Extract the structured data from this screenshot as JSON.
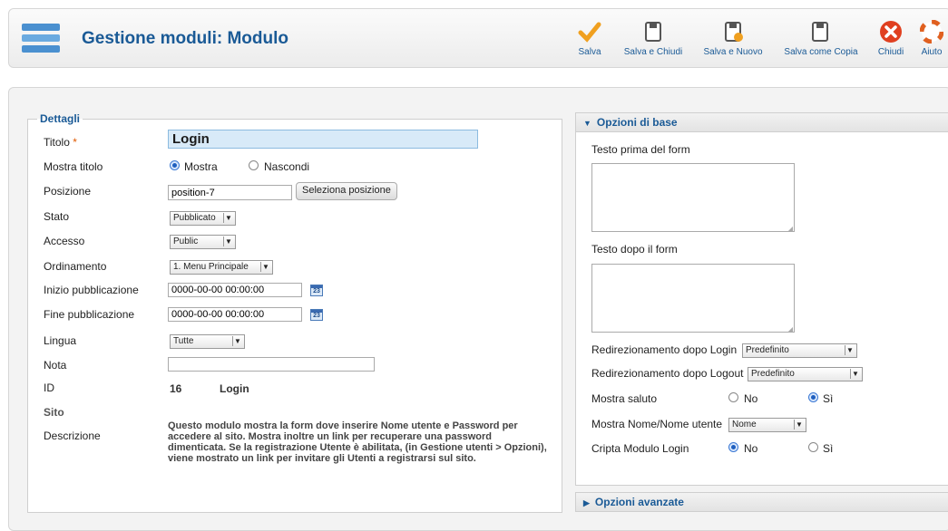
{
  "toolbar": {
    "title": "Gestione moduli: Modulo",
    "buttons": {
      "save": "Salva",
      "save_close": "Salva e Chiudi",
      "save_new": "Salva e Nuovo",
      "save_copy": "Salva come Copia",
      "close": "Chiudi",
      "help": "Aiuto"
    }
  },
  "details": {
    "legend": "Dettagli",
    "title_label": "Titolo",
    "required_mark": "*",
    "title_value": "Login",
    "show_title_label": "Mostra titolo",
    "show_title_options": [
      "Mostra",
      "Nascondi"
    ],
    "show_title_selected": "Mostra",
    "position_label": "Posizione",
    "position_value": "position-7",
    "position_button": "Seleziona posizione",
    "state_label": "Stato",
    "state_value": "Pubblicato",
    "access_label": "Accesso",
    "access_value": "Public",
    "ordering_label": "Ordinamento",
    "ordering_value": "1. Menu Principale",
    "publish_up_label": "Inizio pubblicazione",
    "publish_up_value": "0000-00-00 00:00:00",
    "publish_down_label": "Fine pubblicazione",
    "publish_down_value": "0000-00-00 00:00:00",
    "calendar_day": "23",
    "language_label": "Lingua",
    "language_value": "Tutte",
    "note_label": "Nota",
    "note_value": "",
    "id_label": "ID",
    "id_value": "16",
    "id_name": "Login",
    "site_label": "Sito",
    "description_label": "Descrizione",
    "description_text": "Questo modulo mostra la form dove inserire Nome utente e Password per accedere al sito. Mostra inoltre un link per recuperare una password dimenticata. Se la registrazione Utente è abilitata, (in Gestione utenti > Opzioni), viene mostrato un link per invitare gli Utenti a registrarsi sul sito."
  },
  "basic_options": {
    "header": "Opzioni di base",
    "pretext_label": "Testo prima del form",
    "pretext_value": "",
    "posttext_label": "Testo dopo il form",
    "posttext_value": "",
    "login_redirect_label": "Redirezionamento dopo Login",
    "login_redirect_value": "Predefinito",
    "logout_redirect_label": "Redirezionamento dopo Logout",
    "logout_redirect_value": "Predefinito",
    "greeting_label": "Mostra saluto",
    "greeting_options": [
      "No",
      "Sì"
    ],
    "greeting_selected": "Sì",
    "name_label": "Mostra Nome/Nome utente",
    "name_value": "Nome",
    "encrypt_label": "Cripta Modulo Login",
    "encrypt_options": [
      "No",
      "Sì"
    ],
    "encrypt_selected": "No"
  },
  "advanced_options": {
    "header": "Opzioni avanzate"
  },
  "colors": {
    "accent": "#1a5a96",
    "save_check": "#f0a020",
    "close_red": "#e04020"
  }
}
